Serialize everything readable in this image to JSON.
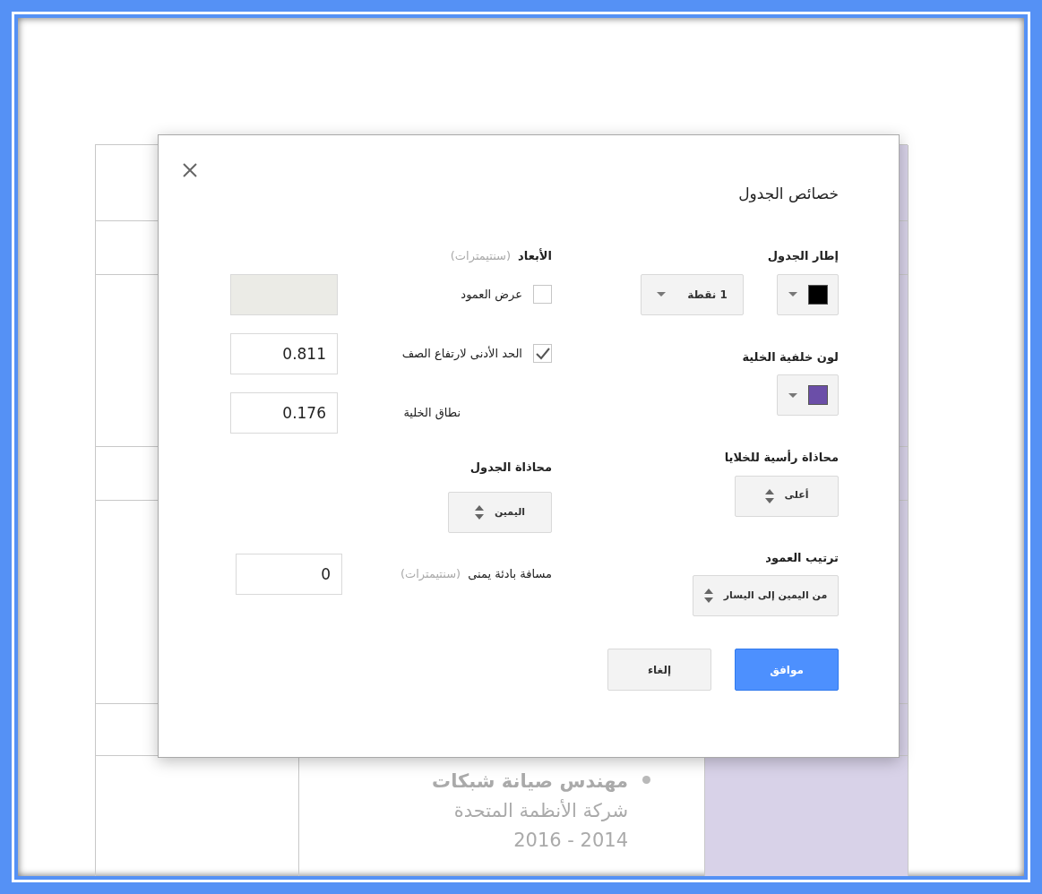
{
  "background_document": {
    "bullet_items": [
      {
        "lines": [
          "مهندس صيانة شبكات",
          "شركة الأنظمة المتحدة",
          "2014 - 2016"
        ]
      }
    ]
  },
  "dialog": {
    "title": "خصائص الجدول",
    "table_border": {
      "label": "إطار الجدول",
      "color": "#000000",
      "width": "1 نقطة"
    },
    "cell_background": {
      "label": "لون خلفية الخلية",
      "color": "#6b4ea8"
    },
    "vertical_alignment": {
      "label": "محاذاة رأسية للخلايا",
      "value": "أعلى"
    },
    "column_order": {
      "label": "ترتيب العمود",
      "value": "من اليمين إلى اليسار"
    },
    "dimensions": {
      "label": "الأبعاد",
      "unit": "(سنتيمترات)",
      "rows": [
        {
          "kind": "checkbox",
          "label": "عرض العمود",
          "checked": false
        },
        {
          "kind": "checkbox",
          "label": "الحد الأدنى لارتفاع الصف",
          "checked": true,
          "value": "0.811"
        },
        {
          "kind": "plain",
          "label": "نطاق الخلية",
          "value": "0.176"
        }
      ]
    },
    "table_alignment": {
      "label": "محاذاة الجدول",
      "value": "اليمين"
    },
    "right_indent": {
      "label": "مسافة بادئة يمنى",
      "unit": "(سنتيمترات)",
      "value": "0"
    },
    "buttons": [
      {
        "label": "موافق",
        "kind": "primary"
      },
      {
        "label": "إلغاء",
        "kind": "secondary"
      }
    ]
  }
}
